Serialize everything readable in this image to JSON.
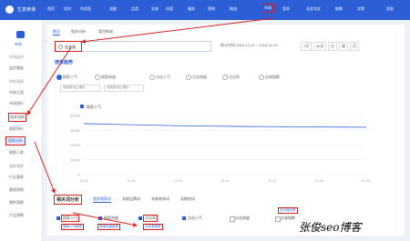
{
  "app": {
    "name": "生意参谋"
  },
  "topnav": {
    "items": [
      "首页",
      "实时",
      "作战室",
      "流量",
      "品类",
      "交易",
      "内容",
      "服务",
      "营销",
      "物流",
      "市场",
      "竞争",
      "业务专区",
      "取数",
      "学院"
    ],
    "active": "市场",
    "right_text": "消息"
  },
  "sidebar": {
    "top_label": "市场",
    "groups": [
      "市场监控",
      "供给洞察",
      "搜索洞察",
      "客群洞察"
    ],
    "items": [
      "监控看板",
      "市场大盘",
      "市场排行",
      "搜索排行",
      "搜索分析",
      "搜索人群",
      "行业客群",
      "客群透视",
      "属性洞察",
      "产品洞察"
    ],
    "active_item": "搜索分析",
    "boxed_item": "搜索洞察"
  },
  "main": {
    "tabs": [
      "概况",
      "相关分析",
      "类目构成"
    ],
    "active_tab": "概况",
    "search_value": "连衣裙",
    "date_range": "统计时间 2018-12-13 ~ 2018-12-19",
    "filters": [
      "7天",
      "30天",
      "日",
      "周",
      "月"
    ],
    "trend": {
      "title": "搜索趋势",
      "metrics": [
        "搜索人气",
        "搜索热度",
        "点击人气",
        "点击热度",
        "点击率",
        "交易指数"
      ],
      "selected_metric": "搜索人气",
      "compare_select": "请选择对比指标"
    },
    "bottom": {
      "title": "相关词分析",
      "tabs": [
        "相关搜索词",
        "关联品牌词",
        "关联修饰词",
        "关联热词"
      ],
      "active_tab": "相关搜索词",
      "checks": [
        {
          "label": "搜索人气",
          "on": true,
          "boxed": true
        },
        {
          "label": "搜索热度",
          "on": true,
          "boxed": false
        },
        {
          "label": "点击率",
          "on": true,
          "boxed": true
        },
        {
          "label": "点击人气",
          "on": true,
          "boxed": false
        },
        {
          "label": "点击热度",
          "on": false,
          "boxed": false
        },
        {
          "label": "交易指数",
          "on": false,
          "boxed": false
        }
      ],
      "sub_labels": [
        "搜索人气趋势",
        "搜索热度趋势",
        "点击率趋势",
        "支付转化率"
      ]
    }
  },
  "chart_data": {
    "type": "line",
    "series": [
      {
        "name": "搜索人气",
        "values": [
          69000,
          67500,
          66200,
          65400,
          64900,
          64500,
          64100
        ]
      }
    ],
    "x": [
      "12-13",
      "12-14",
      "12-15",
      "12-16",
      "12-17",
      "12-18",
      "12-19"
    ],
    "yticks": [
      "80,000",
      "60,000",
      "40,000",
      "20,000",
      "0"
    ],
    "ylim": [
      0,
      80000
    ],
    "line_color": "#2c5fd6"
  },
  "watermark": {
    "text": "张俊seo博客"
  },
  "colors": {
    "brand": "#2c5fd6",
    "annotation": "#d62020"
  }
}
